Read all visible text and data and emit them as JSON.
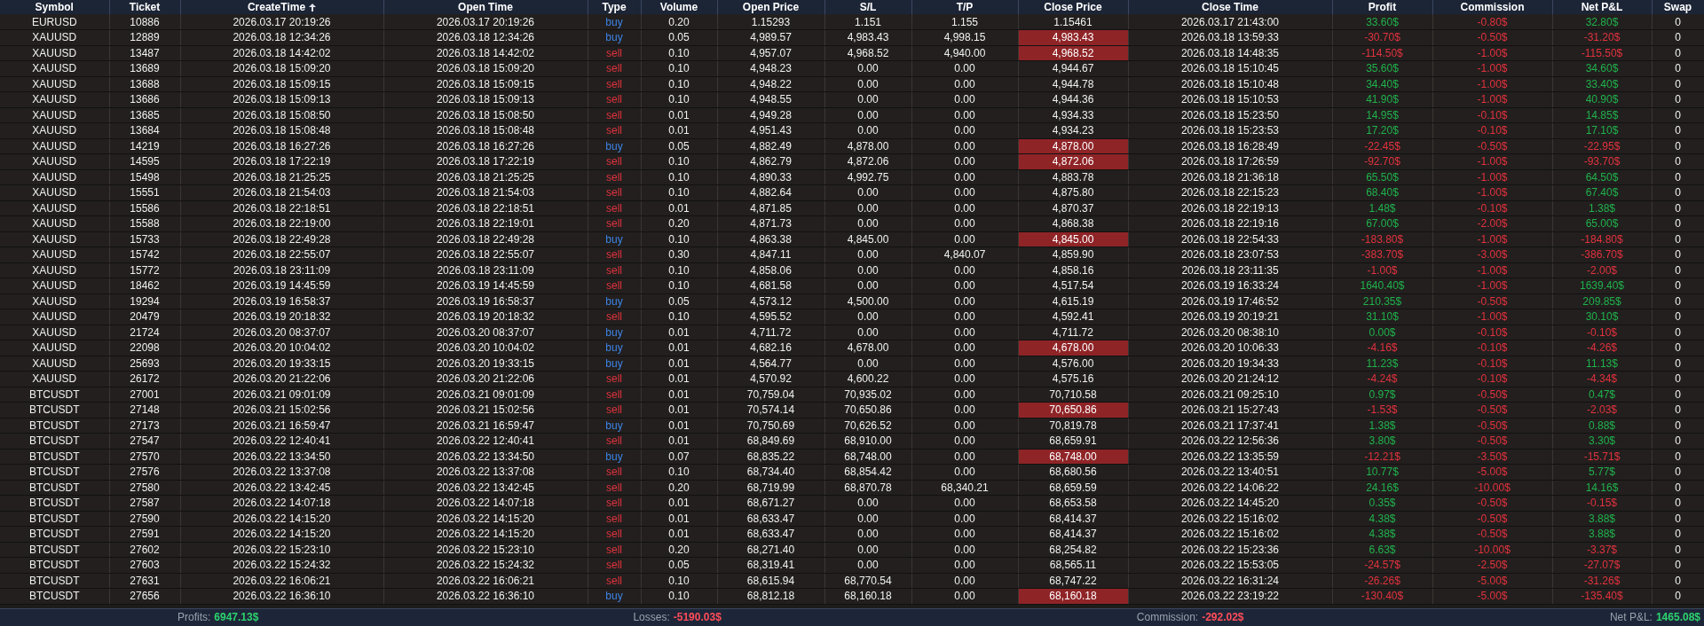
{
  "columns": [
    {
      "label": "Symbol",
      "sorted": false
    },
    {
      "label": "Ticket",
      "sorted": false
    },
    {
      "label": "CreateTime",
      "sorted": true
    },
    {
      "label": "Open Time",
      "sorted": false
    },
    {
      "label": "Type",
      "sorted": false
    },
    {
      "label": "Volume",
      "sorted": false
    },
    {
      "label": "Open Price",
      "sorted": false
    },
    {
      "label": "S/L",
      "sorted": false
    },
    {
      "label": "T/P",
      "sorted": false
    },
    {
      "label": "Close Price",
      "sorted": false
    },
    {
      "label": "Close Time",
      "sorted": false
    },
    {
      "label": "Profit",
      "sorted": false
    },
    {
      "label": "Commission",
      "sorted": false
    },
    {
      "label": "Net P&L",
      "sorted": false
    },
    {
      "label": "Swap",
      "sorted": false
    }
  ],
  "rows": [
    {
      "cells": [
        "EURUSD",
        "10886",
        "2026.03.17 20:19:26",
        "2026.03.17 20:19:26",
        "buy",
        "0.20",
        "1.15293",
        "1.151",
        "1.155",
        "1.15461",
        "2026.03.17 21:43:00",
        "33.60$",
        "-0.80$",
        "32.80$",
        "0"
      ],
      "is_buy": true,
      "close_hit": false,
      "profit_gain": true,
      "net_gain": true
    },
    {
      "cells": [
        "XAUUSD",
        "12889",
        "2026.03.18 12:34:26",
        "2026.03.18 12:34:26",
        "buy",
        "0.05",
        "4,989.57",
        "4,983.43",
        "4,998.15",
        "4,983.43",
        "2026.03.18 13:59:33",
        "-30.70$",
        "-0.50$",
        "-31.20$",
        "0"
      ],
      "is_buy": true,
      "close_hit": true,
      "profit_gain": false,
      "net_gain": false
    },
    {
      "cells": [
        "XAUUSD",
        "13487",
        "2026.03.18 14:42:02",
        "2026.03.18 14:42:02",
        "sell",
        "0.10",
        "4,957.07",
        "4,968.52",
        "4,940.00",
        "4,968.52",
        "2026.03.18 14:48:35",
        "-114.50$",
        "-1.00$",
        "-115.50$",
        "0"
      ],
      "is_buy": false,
      "close_hit": true,
      "profit_gain": false,
      "net_gain": false
    },
    {
      "cells": [
        "XAUUSD",
        "13689",
        "2026.03.18 15:09:20",
        "2026.03.18 15:09:20",
        "sell",
        "0.10",
        "4,948.23",
        "0.00",
        "0.00",
        "4,944.67",
        "2026.03.18 15:10:45",
        "35.60$",
        "-1.00$",
        "34.60$",
        "0"
      ],
      "is_buy": false,
      "close_hit": false,
      "profit_gain": true,
      "net_gain": true
    },
    {
      "cells": [
        "XAUUSD",
        "13688",
        "2026.03.18 15:09:15",
        "2026.03.18 15:09:15",
        "sell",
        "0.10",
        "4,948.22",
        "0.00",
        "0.00",
        "4,944.78",
        "2026.03.18 15:10:48",
        "34.40$",
        "-1.00$",
        "33.40$",
        "0"
      ],
      "is_buy": false,
      "close_hit": false,
      "profit_gain": true,
      "net_gain": true
    },
    {
      "cells": [
        "XAUUSD",
        "13686",
        "2026.03.18 15:09:13",
        "2026.03.18 15:09:13",
        "sell",
        "0.10",
        "4,948.55",
        "0.00",
        "0.00",
        "4,944.36",
        "2026.03.18 15:10:53",
        "41.90$",
        "-1.00$",
        "40.90$",
        "0"
      ],
      "is_buy": false,
      "close_hit": false,
      "profit_gain": true,
      "net_gain": true
    },
    {
      "cells": [
        "XAUUSD",
        "13685",
        "2026.03.18 15:08:50",
        "2026.03.18 15:08:50",
        "sell",
        "0.01",
        "4,949.28",
        "0.00",
        "0.00",
        "4,934.33",
        "2026.03.18 15:23:50",
        "14.95$",
        "-0.10$",
        "14.85$",
        "0"
      ],
      "is_buy": false,
      "close_hit": false,
      "profit_gain": true,
      "net_gain": true
    },
    {
      "cells": [
        "XAUUSD",
        "13684",
        "2026.03.18 15:08:48",
        "2026.03.18 15:08:48",
        "sell",
        "0.01",
        "4,951.43",
        "0.00",
        "0.00",
        "4,934.23",
        "2026.03.18 15:23:53",
        "17.20$",
        "-0.10$",
        "17.10$",
        "0"
      ],
      "is_buy": false,
      "close_hit": false,
      "profit_gain": true,
      "net_gain": true
    },
    {
      "cells": [
        "XAUUSD",
        "14219",
        "2026.03.18 16:27:26",
        "2026.03.18 16:27:26",
        "buy",
        "0.05",
        "4,882.49",
        "4,878.00",
        "0.00",
        "4,878.00",
        "2026.03.18 16:28:49",
        "-22.45$",
        "-0.50$",
        "-22.95$",
        "0"
      ],
      "is_buy": true,
      "close_hit": true,
      "profit_gain": false,
      "net_gain": false
    },
    {
      "cells": [
        "XAUUSD",
        "14595",
        "2026.03.18 17:22:19",
        "2026.03.18 17:22:19",
        "sell",
        "0.10",
        "4,862.79",
        "4,872.06",
        "0.00",
        "4,872.06",
        "2026.03.18 17:26:59",
        "-92.70$",
        "-1.00$",
        "-93.70$",
        "0"
      ],
      "is_buy": false,
      "close_hit": true,
      "profit_gain": false,
      "net_gain": false
    },
    {
      "cells": [
        "XAUUSD",
        "15498",
        "2026.03.18 21:25:25",
        "2026.03.18 21:25:25",
        "sell",
        "0.10",
        "4,890.33",
        "4,992.75",
        "0.00",
        "4,883.78",
        "2026.03.18 21:36:18",
        "65.50$",
        "-1.00$",
        "64.50$",
        "0"
      ],
      "is_buy": false,
      "close_hit": false,
      "profit_gain": true,
      "net_gain": true
    },
    {
      "cells": [
        "XAUUSD",
        "15551",
        "2026.03.18 21:54:03",
        "2026.03.18 21:54:03",
        "sell",
        "0.10",
        "4,882.64",
        "0.00",
        "0.00",
        "4,875.80",
        "2026.03.18 22:15:23",
        "68.40$",
        "-1.00$",
        "67.40$",
        "0"
      ],
      "is_buy": false,
      "close_hit": false,
      "profit_gain": true,
      "net_gain": true
    },
    {
      "cells": [
        "XAUUSD",
        "15586",
        "2026.03.18 22:18:51",
        "2026.03.18 22:18:51",
        "sell",
        "0.01",
        "4,871.85",
        "0.00",
        "0.00",
        "4,870.37",
        "2026.03.18 22:19:13",
        "1.48$",
        "-0.10$",
        "1.38$",
        "0"
      ],
      "is_buy": false,
      "close_hit": false,
      "profit_gain": true,
      "net_gain": true
    },
    {
      "cells": [
        "XAUUSD",
        "15588",
        "2026.03.18 22:19:00",
        "2026.03.18 22:19:01",
        "sell",
        "0.20",
        "4,871.73",
        "0.00",
        "0.00",
        "4,868.38",
        "2026.03.18 22:19:16",
        "67.00$",
        "-2.00$",
        "65.00$",
        "0"
      ],
      "is_buy": false,
      "close_hit": false,
      "profit_gain": true,
      "net_gain": true
    },
    {
      "cells": [
        "XAUUSD",
        "15733",
        "2026.03.18 22:49:28",
        "2026.03.18 22:49:28",
        "buy",
        "0.10",
        "4,863.38",
        "4,845.00",
        "0.00",
        "4,845.00",
        "2026.03.18 22:54:33",
        "-183.80$",
        "-1.00$",
        "-184.80$",
        "0"
      ],
      "is_buy": true,
      "close_hit": true,
      "profit_gain": false,
      "net_gain": false
    },
    {
      "cells": [
        "XAUUSD",
        "15742",
        "2026.03.18 22:55:07",
        "2026.03.18 22:55:07",
        "sell",
        "0.30",
        "4,847.11",
        "0.00",
        "4,840.07",
        "4,859.90",
        "2026.03.18 23:07:53",
        "-383.70$",
        "-3.00$",
        "-386.70$",
        "0"
      ],
      "is_buy": false,
      "close_hit": false,
      "profit_gain": false,
      "net_gain": false
    },
    {
      "cells": [
        "XAUUSD",
        "15772",
        "2026.03.18 23:11:09",
        "2026.03.18 23:11:09",
        "sell",
        "0.10",
        "4,858.06",
        "0.00",
        "0.00",
        "4,858.16",
        "2026.03.18 23:11:35",
        "-1.00$",
        "-1.00$",
        "-2.00$",
        "0"
      ],
      "is_buy": false,
      "close_hit": false,
      "profit_gain": false,
      "net_gain": false
    },
    {
      "cells": [
        "XAUUSD",
        "18462",
        "2026.03.19 14:45:59",
        "2026.03.19 14:45:59",
        "sell",
        "0.10",
        "4,681.58",
        "0.00",
        "0.00",
        "4,517.54",
        "2026.03.19 16:33:24",
        "1640.40$",
        "-1.00$",
        "1639.40$",
        "0"
      ],
      "is_buy": false,
      "close_hit": false,
      "profit_gain": true,
      "net_gain": true
    },
    {
      "cells": [
        "XAUUSD",
        "19294",
        "2026.03.19 16:58:37",
        "2026.03.19 16:58:37",
        "buy",
        "0.05",
        "4,573.12",
        "4,500.00",
        "0.00",
        "4,615.19",
        "2026.03.19 17:46:52",
        "210.35$",
        "-0.50$",
        "209.85$",
        "0"
      ],
      "is_buy": true,
      "close_hit": false,
      "profit_gain": true,
      "net_gain": true
    },
    {
      "cells": [
        "XAUUSD",
        "20479",
        "2026.03.19 20:18:32",
        "2026.03.19 20:18:32",
        "sell",
        "0.10",
        "4,595.52",
        "0.00",
        "0.00",
        "4,592.41",
        "2026.03.19 20:19:21",
        "31.10$",
        "-1.00$",
        "30.10$",
        "0"
      ],
      "is_buy": false,
      "close_hit": false,
      "profit_gain": true,
      "net_gain": true
    },
    {
      "cells": [
        "XAUUSD",
        "21724",
        "2026.03.20 08:37:07",
        "2026.03.20 08:37:07",
        "buy",
        "0.01",
        "4,711.72",
        "0.00",
        "0.00",
        "4,711.72",
        "2026.03.20 08:38:10",
        "0.00$",
        "-0.10$",
        "-0.10$",
        "0"
      ],
      "is_buy": true,
      "close_hit": false,
      "profit_gain": true,
      "net_gain": false
    },
    {
      "cells": [
        "XAUUSD",
        "22098",
        "2026.03.20 10:04:02",
        "2026.03.20 10:04:02",
        "buy",
        "0.01",
        "4,682.16",
        "4,678.00",
        "0.00",
        "4,678.00",
        "2026.03.20 10:06:33",
        "-4.16$",
        "-0.10$",
        "-4.26$",
        "0"
      ],
      "is_buy": true,
      "close_hit": true,
      "profit_gain": false,
      "net_gain": false
    },
    {
      "cells": [
        "XAUUSD",
        "25693",
        "2026.03.20 19:33:15",
        "2026.03.20 19:33:15",
        "buy",
        "0.01",
        "4,564.77",
        "0.00",
        "0.00",
        "4,576.00",
        "2026.03.20 19:34:33",
        "11.23$",
        "-0.10$",
        "11.13$",
        "0"
      ],
      "is_buy": true,
      "close_hit": false,
      "profit_gain": true,
      "net_gain": true
    },
    {
      "cells": [
        "XAUUSD",
        "26172",
        "2026.03.20 21:22:06",
        "2026.03.20 21:22:06",
        "sell",
        "0.01",
        "4,570.92",
        "4,600.22",
        "0.00",
        "4,575.16",
        "2026.03.20 21:24:12",
        "-4.24$",
        "-0.10$",
        "-4.34$",
        "0"
      ],
      "is_buy": false,
      "close_hit": false,
      "profit_gain": false,
      "net_gain": false
    },
    {
      "cells": [
        "BTCUSDT",
        "27001",
        "2026.03.21 09:01:09",
        "2026.03.21 09:01:09",
        "sell",
        "0.01",
        "70,759.04",
        "70,935.02",
        "0.00",
        "70,710.58",
        "2026.03.21 09:25:10",
        "0.97$",
        "-0.50$",
        "0.47$",
        "0"
      ],
      "is_buy": false,
      "close_hit": false,
      "profit_gain": true,
      "net_gain": true
    },
    {
      "cells": [
        "BTCUSDT",
        "27148",
        "2026.03.21 15:02:56",
        "2026.03.21 15:02:56",
        "sell",
        "0.01",
        "70,574.14",
        "70,650.86",
        "0.00",
        "70,650.86",
        "2026.03.21 15:27:43",
        "-1.53$",
        "-0.50$",
        "-2.03$",
        "0"
      ],
      "is_buy": false,
      "close_hit": true,
      "profit_gain": false,
      "net_gain": false
    },
    {
      "cells": [
        "BTCUSDT",
        "27173",
        "2026.03.21 16:59:47",
        "2026.03.21 16:59:47",
        "buy",
        "0.01",
        "70,750.69",
        "70,626.52",
        "0.00",
        "70,819.78",
        "2026.03.21 17:37:41",
        "1.38$",
        "-0.50$",
        "0.88$",
        "0"
      ],
      "is_buy": true,
      "close_hit": false,
      "profit_gain": true,
      "net_gain": true
    },
    {
      "cells": [
        "BTCUSDT",
        "27547",
        "2026.03.22 12:40:41",
        "2026.03.22 12:40:41",
        "sell",
        "0.01",
        "68,849.69",
        "68,910.00",
        "0.00",
        "68,659.91",
        "2026.03.22 12:56:36",
        "3.80$",
        "-0.50$",
        "3.30$",
        "0"
      ],
      "is_buy": false,
      "close_hit": false,
      "profit_gain": true,
      "net_gain": true
    },
    {
      "cells": [
        "BTCUSDT",
        "27570",
        "2026.03.22 13:34:50",
        "2026.03.22 13:34:50",
        "buy",
        "0.07",
        "68,835.22",
        "68,748.00",
        "0.00",
        "68,748.00",
        "2026.03.22 13:35:59",
        "-12.21$",
        "-3.50$",
        "-15.71$",
        "0"
      ],
      "is_buy": true,
      "close_hit": true,
      "profit_gain": false,
      "net_gain": false
    },
    {
      "cells": [
        "BTCUSDT",
        "27576",
        "2026.03.22 13:37:08",
        "2026.03.22 13:37:08",
        "sell",
        "0.10",
        "68,734.40",
        "68,854.42",
        "0.00",
        "68,680.56",
        "2026.03.22 13:40:51",
        "10.77$",
        "-5.00$",
        "5.77$",
        "0"
      ],
      "is_buy": false,
      "close_hit": false,
      "profit_gain": true,
      "net_gain": true
    },
    {
      "cells": [
        "BTCUSDT",
        "27580",
        "2026.03.22 13:42:45",
        "2026.03.22 13:42:45",
        "sell",
        "0.20",
        "68,719.99",
        "68,870.78",
        "68,340.21",
        "68,659.59",
        "2026.03.22 14:06:22",
        "24.16$",
        "-10.00$",
        "14.16$",
        "0"
      ],
      "is_buy": false,
      "close_hit": false,
      "profit_gain": true,
      "net_gain": true
    },
    {
      "cells": [
        "BTCUSDT",
        "27587",
        "2026.03.22 14:07:18",
        "2026.03.22 14:07:18",
        "sell",
        "0.01",
        "68,671.27",
        "0.00",
        "0.00",
        "68,653.58",
        "2026.03.22 14:45:20",
        "0.35$",
        "-0.50$",
        "-0.15$",
        "0"
      ],
      "is_buy": false,
      "close_hit": false,
      "profit_gain": true,
      "net_gain": false
    },
    {
      "cells": [
        "BTCUSDT",
        "27590",
        "2026.03.22 14:15:20",
        "2026.03.22 14:15:20",
        "sell",
        "0.01",
        "68,633.47",
        "0.00",
        "0.00",
        "68,414.37",
        "2026.03.22 15:16:02",
        "4.38$",
        "-0.50$",
        "3.88$",
        "0"
      ],
      "is_buy": false,
      "close_hit": false,
      "profit_gain": true,
      "net_gain": true
    },
    {
      "cells": [
        "BTCUSDT",
        "27591",
        "2026.03.22 14:15:20",
        "2026.03.22 14:15:20",
        "sell",
        "0.01",
        "68,633.47",
        "0.00",
        "0.00",
        "68,414.37",
        "2026.03.22 15:16:02",
        "4.38$",
        "-0.50$",
        "3.88$",
        "0"
      ],
      "is_buy": false,
      "close_hit": false,
      "profit_gain": true,
      "net_gain": true
    },
    {
      "cells": [
        "BTCUSDT",
        "27602",
        "2026.03.22 15:23:10",
        "2026.03.22 15:23:10",
        "sell",
        "0.20",
        "68,271.40",
        "0.00",
        "0.00",
        "68,254.82",
        "2026.03.22 15:23:36",
        "6.63$",
        "-10.00$",
        "-3.37$",
        "0"
      ],
      "is_buy": false,
      "close_hit": false,
      "profit_gain": true,
      "net_gain": false
    },
    {
      "cells": [
        "BTCUSDT",
        "27603",
        "2026.03.22 15:24:32",
        "2026.03.22 15:24:32",
        "sell",
        "0.05",
        "68,319.41",
        "0.00",
        "0.00",
        "68,565.11",
        "2026.03.22 15:53:05",
        "-24.57$",
        "-2.50$",
        "-27.07$",
        "0"
      ],
      "is_buy": false,
      "close_hit": false,
      "profit_gain": false,
      "net_gain": false
    },
    {
      "cells": [
        "BTCUSDT",
        "27631",
        "2026.03.22 16:06:21",
        "2026.03.22 16:06:21",
        "sell",
        "0.10",
        "68,615.94",
        "68,770.54",
        "0.00",
        "68,747.22",
        "2026.03.22 16:31:24",
        "-26.26$",
        "-5.00$",
        "-31.26$",
        "0"
      ],
      "is_buy": false,
      "close_hit": false,
      "profit_gain": false,
      "net_gain": false
    },
    {
      "cells": [
        "BTCUSDT",
        "27656",
        "2026.03.22 16:36:10",
        "2026.03.22 16:36:10",
        "buy",
        "0.10",
        "68,812.18",
        "68,160.18",
        "0.00",
        "68,160.18",
        "2026.03.22 23:19:22",
        "-130.40$",
        "-5.00$",
        "-135.40$",
        "0"
      ],
      "is_buy": true,
      "close_hit": true,
      "profit_gain": false,
      "net_gain": false
    }
  ],
  "status_bar": [
    {
      "label": "Profits:",
      "value": "6947.13$",
      "gain": true
    },
    {
      "label": "Losses:",
      "value": "-5190.03$",
      "gain": false
    },
    {
      "label": "Commission:",
      "value": "-292.02$",
      "gain": false
    },
    {
      "label": "Net P&L:",
      "value": "1465.08$",
      "gain": true
    }
  ]
}
